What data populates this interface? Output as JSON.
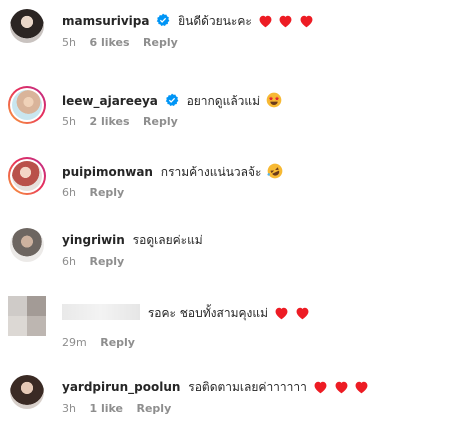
{
  "comments": [
    {
      "username": "mamsurivipa",
      "verified": true,
      "text": "ยินดีด้วยนะคะ",
      "time": "5h",
      "likes": "6 likes",
      "reply": "Reply",
      "emoji": [
        "red-heart",
        "red-heart",
        "red-heart"
      ]
    },
    {
      "username": "leew_ajareeya",
      "verified": true,
      "text": "อยากดูแล้วแม่",
      "time": "5h",
      "likes": "2 likes",
      "reply": "Reply",
      "emoji": [
        "star-struck"
      ]
    },
    {
      "username": "puipimonwan",
      "verified": false,
      "text": "กรามค้างแน่นวลจ้ะ",
      "time": "6h",
      "reply": "Reply",
      "emoji": [
        "rolling-laughing"
      ]
    },
    {
      "username": "yingriwin",
      "verified": false,
      "text": "รอดูเลยค่ะแม่",
      "time": "6h",
      "reply": "Reply"
    },
    {
      "username": "",
      "verified": false,
      "text": "รอคะ ชอบทั้งสามคุงแม่",
      "time": "29m",
      "reply": "Reply",
      "emoji": [
        "red-heart",
        "red-heart"
      ]
    },
    {
      "username": "yardpirun_poolun",
      "verified": false,
      "text": "รอติดตามเลยค่าาาาาา",
      "time": "3h",
      "likes": "1 like",
      "reply": "Reply",
      "emoji": [
        "red-heart",
        "red-heart",
        "red-heart"
      ]
    }
  ],
  "colors": {
    "text": "#262626",
    "meta": "#8e8e8e",
    "verified": "#0095f6",
    "heart": "#ed1c24"
  }
}
